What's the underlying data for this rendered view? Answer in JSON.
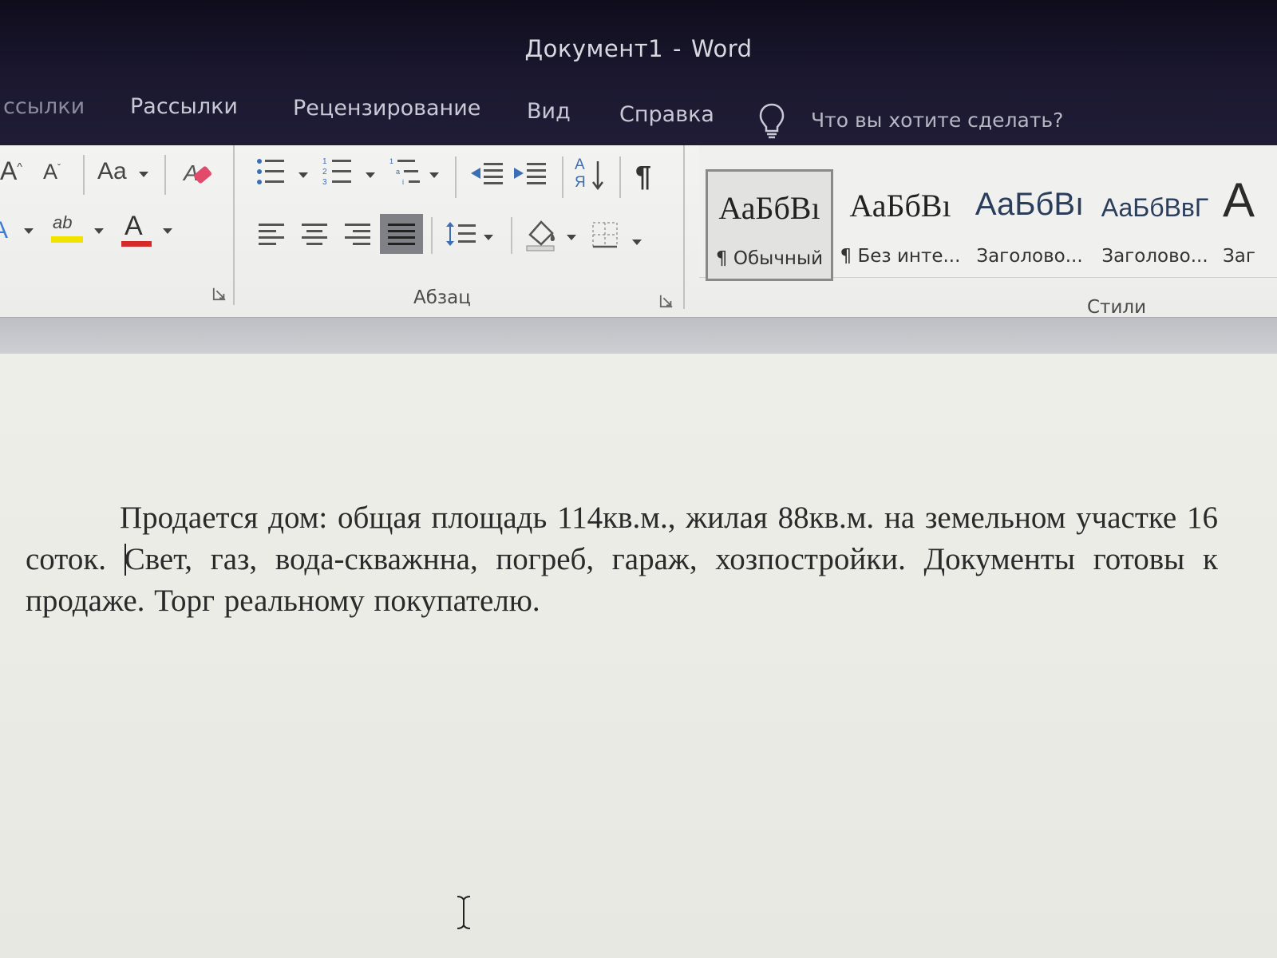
{
  "window": {
    "doc_name": "Документ1",
    "separator": "-",
    "app_name": "Word"
  },
  "tabs": [
    {
      "label": "ссылки"
    },
    {
      "label": "Рассылки"
    },
    {
      "label": "Рецензирование"
    },
    {
      "label": "Вид"
    },
    {
      "label": "Справка"
    }
  ],
  "tell_me": {
    "icon": "lightbulb-icon",
    "placeholder": "Что вы хотите сделать?"
  },
  "ribbon": {
    "font_group": {
      "change_case_label": "Aa",
      "grow_font_glyph": "A",
      "shrink_font_glyph": "A",
      "font_color_glyph": "A",
      "highlight_glyph": "ab",
      "highlight_color": "#f2e200",
      "font_color": "#d42a2a"
    },
    "paragraph_group": {
      "label": "Абзац",
      "sort_glyph_top": "А",
      "sort_glyph_bottom": "Я",
      "pilcrow": "¶",
      "active_alignment": "justify"
    },
    "styles_group": {
      "label": "Стили",
      "styles": [
        {
          "sample": "АаБбВı",
          "name": "¶ Обычный",
          "selected": true
        },
        {
          "sample": "АаБбВı",
          "name": "¶ Без инте..."
        },
        {
          "sample": "АаБбВı",
          "name": "Заголово..."
        },
        {
          "sample": "АаБбВвГ",
          "name": "Заголово..."
        },
        {
          "sample": "А",
          "name": "Заг"
        }
      ]
    }
  },
  "document": {
    "text_before_caret": "Продается дом: общая площадь 114кв.м., жилая 88кв.м. на земельном участке 16 соток. ",
    "text_after_caret": "Свет, газ, вода-скважнна, погреб, гараж, хозпостройки. Документы готовы к продаже. Торг реальному покупателю."
  }
}
